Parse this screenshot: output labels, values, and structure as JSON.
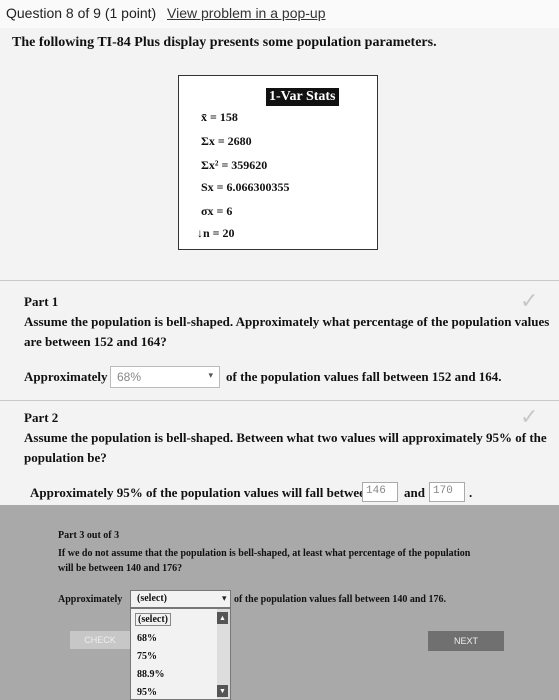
{
  "header": {
    "question_label": "Question 8 of 9 (1 point)",
    "popup_link": "View problem in a pop-up"
  },
  "intro": "The following TI-84 Plus display presents some population parameters.",
  "calc": {
    "title": "1-Var Stats",
    "lines": [
      "x̄ = 158",
      "Σx = 2680",
      "Σx² = 359620",
      "Sx = 6.066300355",
      "σx = 6",
      "↓n = 20"
    ]
  },
  "part1": {
    "heading": "Part 1",
    "question_line1": "Assume the population is bell-shaped. Approximately what percentage of the population values",
    "question_line2": "are between 152 and 164?",
    "answer_prefix": "Approximately",
    "answer_value": "68%",
    "answer_suffix": "of the population values fall between 152 and 164."
  },
  "part2": {
    "heading": "Part 2",
    "question_line1": "Assume the population is bell-shaped. Between what two values will approximately 95% of the",
    "question_line2": "population be?",
    "answer_prefix": "Approximately 95% of the population values will fall between",
    "low_value": "146",
    "and_label": "and",
    "high_value": "170",
    "period": "."
  },
  "part3": {
    "heading": "Part 3 out of 3",
    "question_line1": "If we do not assume that the population is bell-shaped, at least what percentage of the population",
    "question_line2": "will be between 140 and 176?",
    "answer_prefix": "Approximately",
    "select_value": "(select)",
    "answer_suffix": "of the population values fall between 140 and 176.",
    "options": [
      "(select)",
      "68%",
      "75%",
      "88.9%",
      "95%"
    ],
    "check_label": "CHECK",
    "next_label": "NEXT"
  }
}
